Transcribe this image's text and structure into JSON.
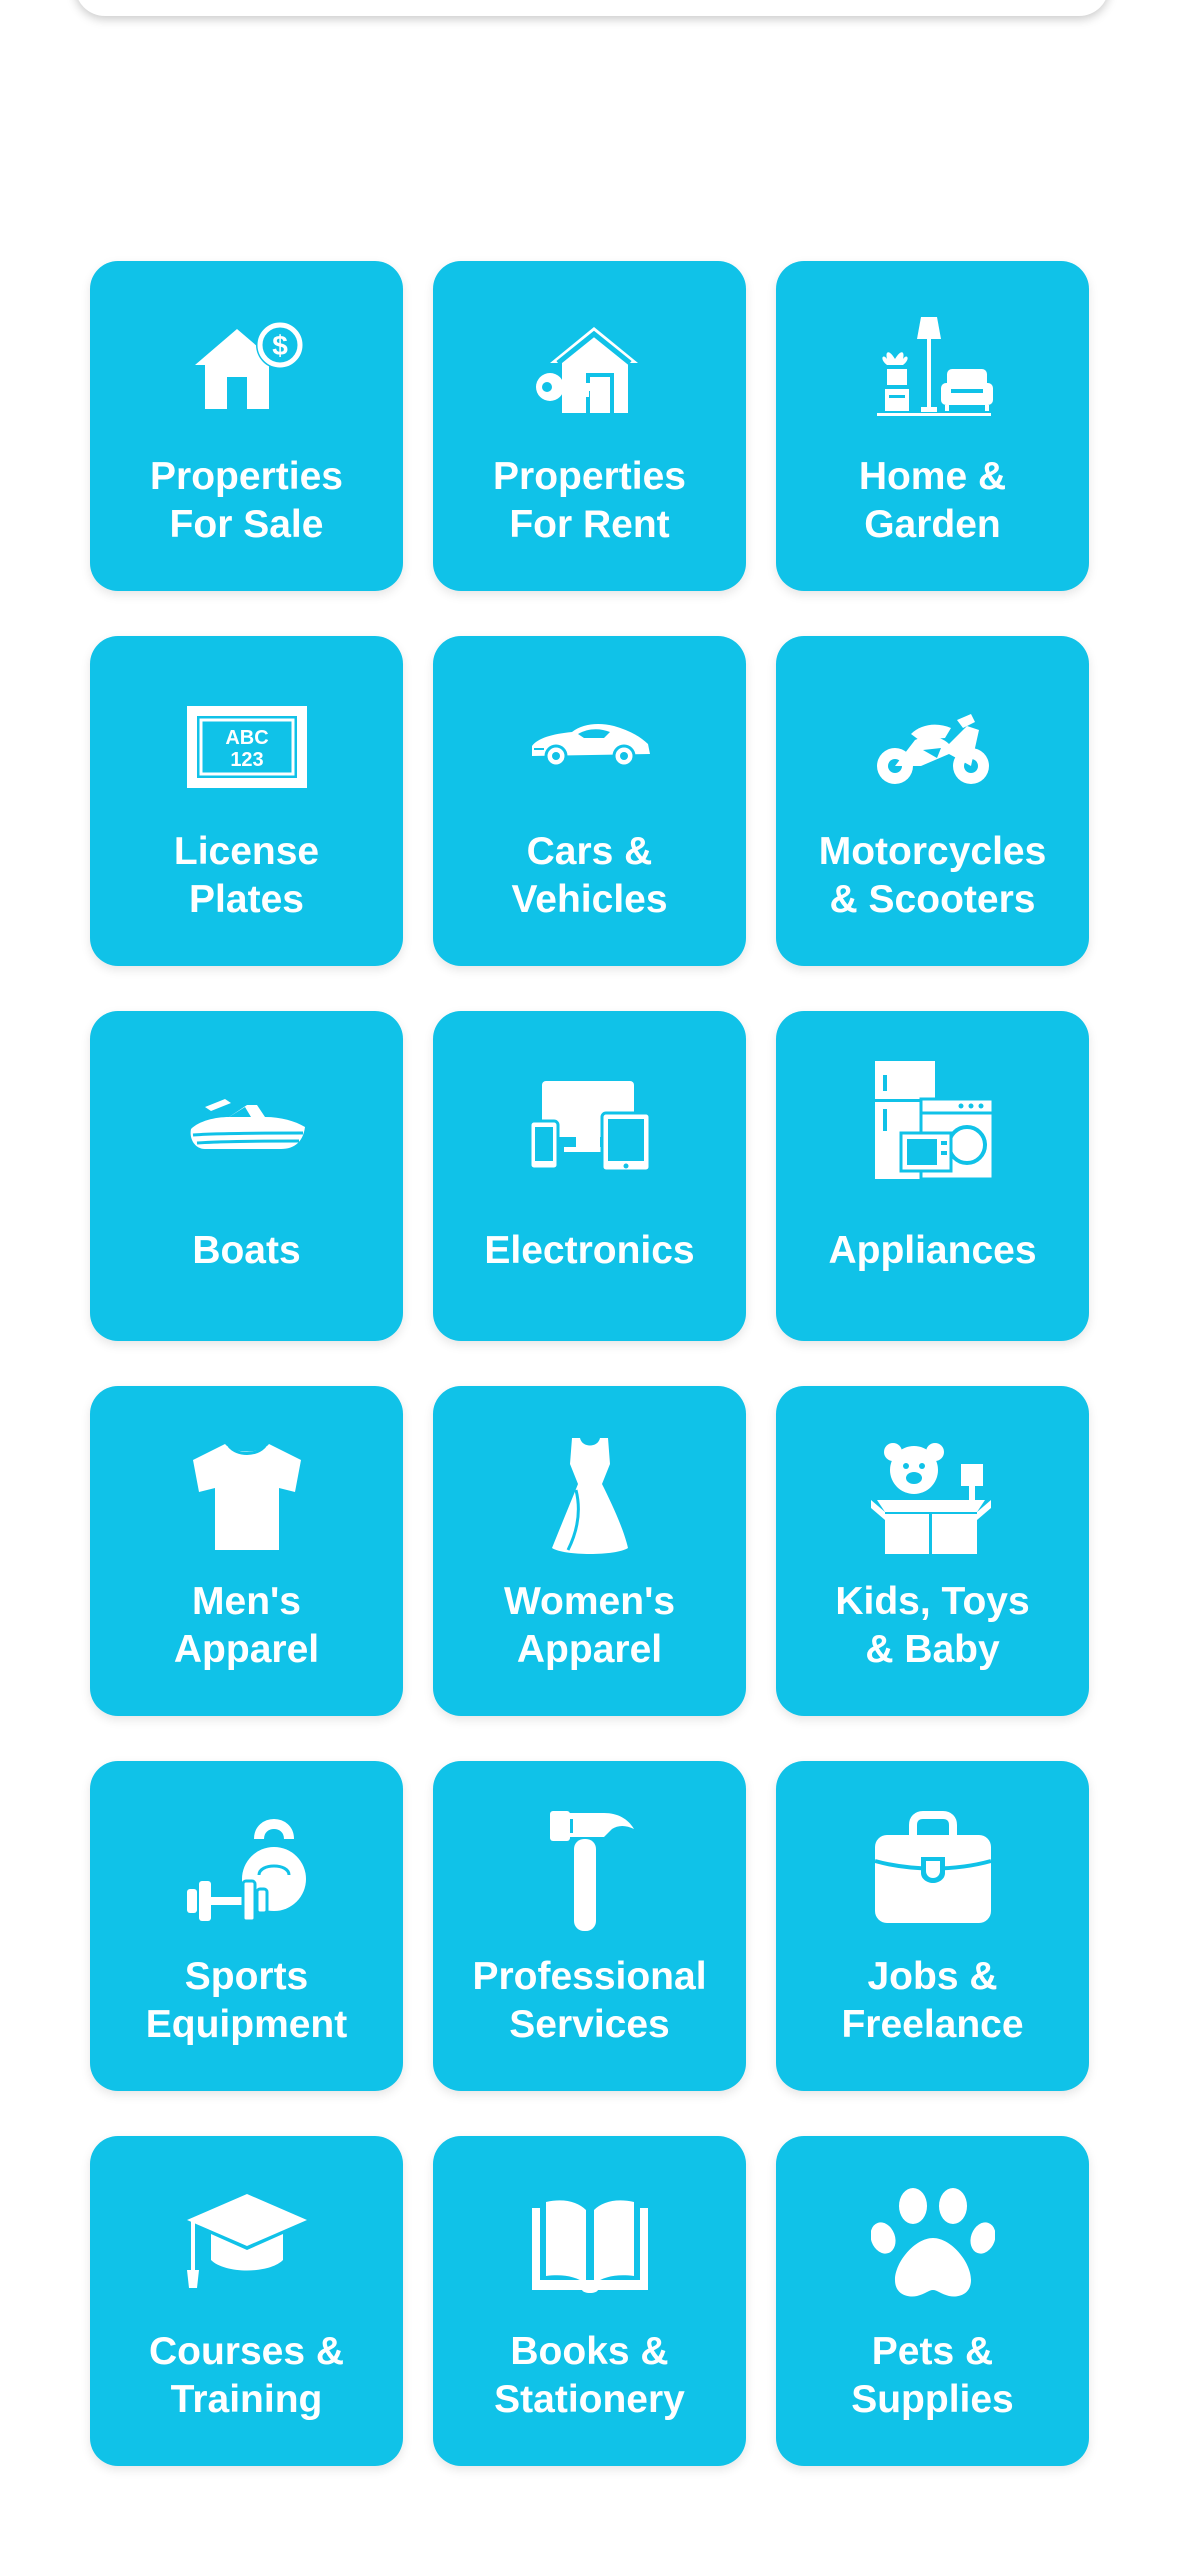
{
  "colors": {
    "tile_bg": "#10c2e8",
    "tile_text": "#ffffff",
    "page_bg": "#ffffff"
  },
  "categories": [
    {
      "label": "Properties\nFor Sale",
      "icon": "house-dollar-icon"
    },
    {
      "label": "Properties\nFor Rent",
      "icon": "house-key-icon"
    },
    {
      "label": "Home &\nGarden",
      "icon": "furniture-icon"
    },
    {
      "label": "License\nPlates",
      "icon": "license-plate-icon",
      "plate_line1": "ABC",
      "plate_line2": "123"
    },
    {
      "label": "Cars &\nVehicles",
      "icon": "car-icon"
    },
    {
      "label": "Motorcycles\n& Scooters",
      "icon": "motorcycle-icon"
    },
    {
      "label": "Boats",
      "icon": "jet-ski-icon"
    },
    {
      "label": "Electronics",
      "icon": "devices-icon"
    },
    {
      "label": "Appliances",
      "icon": "appliances-icon"
    },
    {
      "label": "Men's\nApparel",
      "icon": "tshirt-icon"
    },
    {
      "label": "Women's\nApparel",
      "icon": "dress-icon"
    },
    {
      "label": "Kids, Toys\n& Baby",
      "icon": "toy-box-icon"
    },
    {
      "label": "Sports\nEquipment",
      "icon": "dumbbell-kettlebell-icon"
    },
    {
      "label": "Professional\nServices",
      "icon": "hammer-icon"
    },
    {
      "label": "Jobs &\nFreelance",
      "icon": "briefcase-icon"
    },
    {
      "label": "Courses &\nTraining",
      "icon": "graduation-cap-icon"
    },
    {
      "label": "Books &\nStationery",
      "icon": "open-book-icon"
    },
    {
      "label": "Pets &\nSupplies",
      "icon": "paw-icon"
    }
  ]
}
